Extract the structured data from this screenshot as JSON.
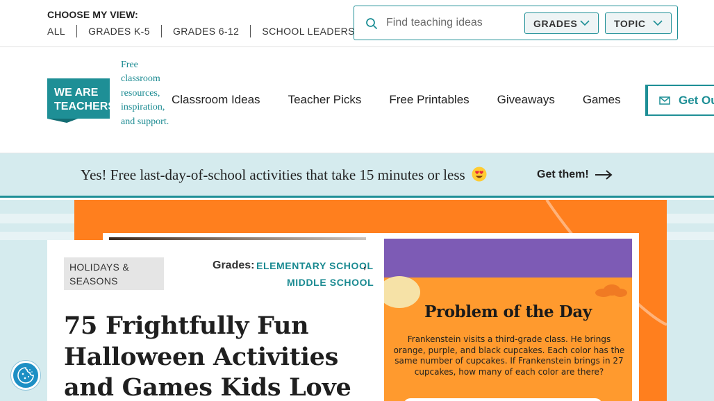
{
  "topbar": {
    "view_label": "CHOOSE MY VIEW:",
    "view_links": [
      "ALL",
      "GRADES K-5",
      "GRADES 6-12",
      "SCHOOL LEADERS"
    ],
    "search": {
      "placeholder": "Find teaching ideas"
    },
    "filters": {
      "grades": "GRADES",
      "topic": "TOPIC"
    }
  },
  "header": {
    "logo": {
      "line1": "WE ARE",
      "line2": "TEACHERS"
    },
    "tagline": "Free classroom resources, inspiration, and support.",
    "nav": [
      "Classroom Ideas",
      "Teacher Picks",
      "Free Printables",
      "Giveaways",
      "Games"
    ],
    "cta": "Get Ou"
  },
  "promo": {
    "text": "Yes! Free last-day-of-school activities that take 15 minutes or less",
    "link": "Get them!"
  },
  "article": {
    "category": "HOLIDAYS & SEASONS",
    "grades_label": "Grades:",
    "grades": [
      "ELEMENTARY SCHOOL",
      "MIDDLE SCHOOL"
    ],
    "grades_separator": ",",
    "title": "75 Frightfully Fun Halloween Activities and Games Kids Love"
  },
  "worksheet": {
    "title": "Problem of the Day",
    "body": "Frankenstein visits a third-grade class. He brings orange, purple, and black cupcakes. Each color has the same number of cupcakes. If Frankenstein brings in 27 cupcakes, how many of each color are there?"
  },
  "colors": {
    "accent": "#1e8f96",
    "banner": "#d5ebee",
    "hero": "#ff7f1e"
  }
}
